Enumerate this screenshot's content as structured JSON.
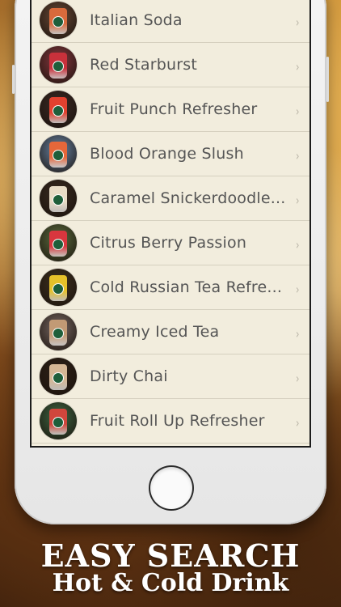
{
  "drinks": [
    {
      "name": "Italian Soda",
      "cup_color": "#d86a3c",
      "bg": "#6a4a38"
    },
    {
      "name": "Red Starburst",
      "cup_color": "#c8313b",
      "bg": "#8a3940"
    },
    {
      "name": "Fruit Punch Refresher",
      "cup_color": "#e2412f",
      "bg": "#3c2a26"
    },
    {
      "name": "Blood Orange Slush",
      "cup_color": "#e5673a",
      "bg": "#6a88aa"
    },
    {
      "name": "Caramel Snickerdoodle...",
      "cup_color": "#e8dcc6",
      "bg": "#3a2c22"
    },
    {
      "name": "Citrus Berry Passion",
      "cup_color": "#d8363e",
      "bg": "#5d7040"
    },
    {
      "name": "Cold Russian Tea Refre...",
      "cup_color": "#e6c12a",
      "bg": "#403220"
    },
    {
      "name": "Creamy Iced Tea",
      "cup_color": "#c29a75",
      "bg": "#7a6a66"
    },
    {
      "name": "Dirty Chai",
      "cup_color": "#d5b795",
      "bg": "#2f2218"
    },
    {
      "name": "Fruit Roll Up Refresher",
      "cup_color": "#d0463c",
      "bg": "#3f6a45"
    }
  ],
  "chevron": "›",
  "promo": {
    "title": "EASY SEARCH",
    "subtitle": "Hot & Cold Drink"
  }
}
